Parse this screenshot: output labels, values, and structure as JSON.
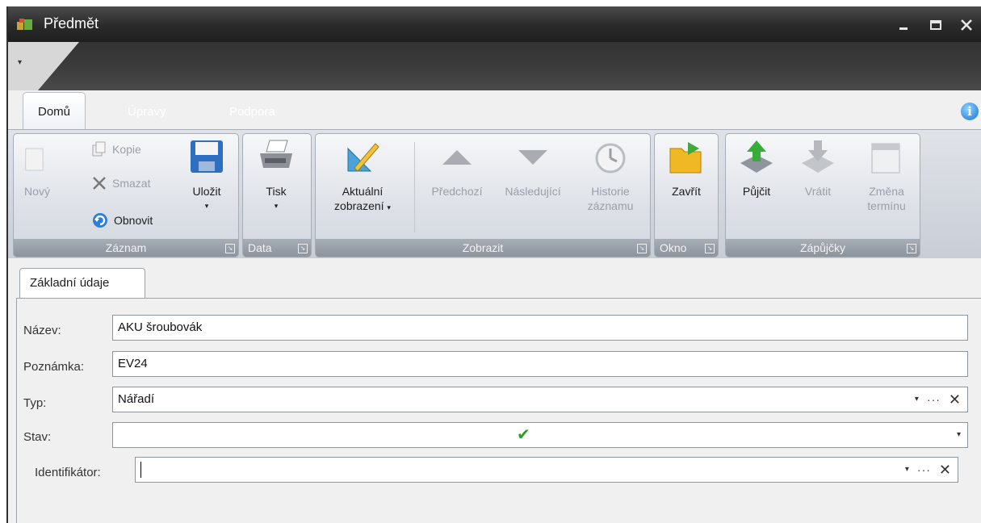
{
  "window": {
    "title": "Předmět",
    "controls": {
      "minimize": "_",
      "maximize": "□",
      "close": "X"
    }
  },
  "qat": {
    "arrow": "▾"
  },
  "tabs": [
    {
      "label": "Domů",
      "active": true
    },
    {
      "label": "Úpravy"
    },
    {
      "label": "Podpora"
    }
  ],
  "help_icon": "i",
  "ribbon": {
    "groups": {
      "zaznam": {
        "caption": "Záznam"
      },
      "data": {
        "caption": "Data"
      },
      "zobrazit": {
        "caption": "Zobrazit"
      },
      "okno": {
        "caption": "Okno"
      },
      "zapujcky": {
        "caption": "Zápůjčky"
      }
    },
    "buttons": {
      "novy": "Nový",
      "kopie": "Kopie",
      "smazat": "Smazat",
      "obnovit": "Obnovit",
      "ulozit": "Uložit",
      "tisk": "Tisk",
      "aktualni_1": "Aktuální",
      "aktualni_2": "zobrazení",
      "predchozi": "Předchozí",
      "nasledujici": "Následující",
      "historie_1": "Historie",
      "historie_2": "záznamu",
      "zavrit": "Zavřít",
      "pujcit": "Půjčit",
      "vratit": "Vrátit",
      "zmena_1": "Změna",
      "zmena_2": "termínu"
    },
    "drop_arrow": "▾",
    "launcher": "↘"
  },
  "content_tab": "Základní údaje",
  "form": {
    "nazev": {
      "label": "Název:",
      "value": "AKU šroubovák"
    },
    "poznamka": {
      "label": "Poznámka:",
      "value": "EV24"
    },
    "typ": {
      "label": "Typ:",
      "value": "Nářadí"
    },
    "stav": {
      "label": "Stav:",
      "value_icon": "check-icon",
      "check": "✔"
    },
    "identifikator": {
      "label": "Identifikátor:",
      "value": ""
    },
    "tools": {
      "drop": "▾",
      "dots": "···",
      "clear": "✕"
    }
  },
  "colors": {
    "titlebar": "#2a2a2a",
    "ribbon": "#d3d8df",
    "check": "#2e9d2e",
    "accent_green": "#3cab3c",
    "folder": "#f0b824"
  }
}
